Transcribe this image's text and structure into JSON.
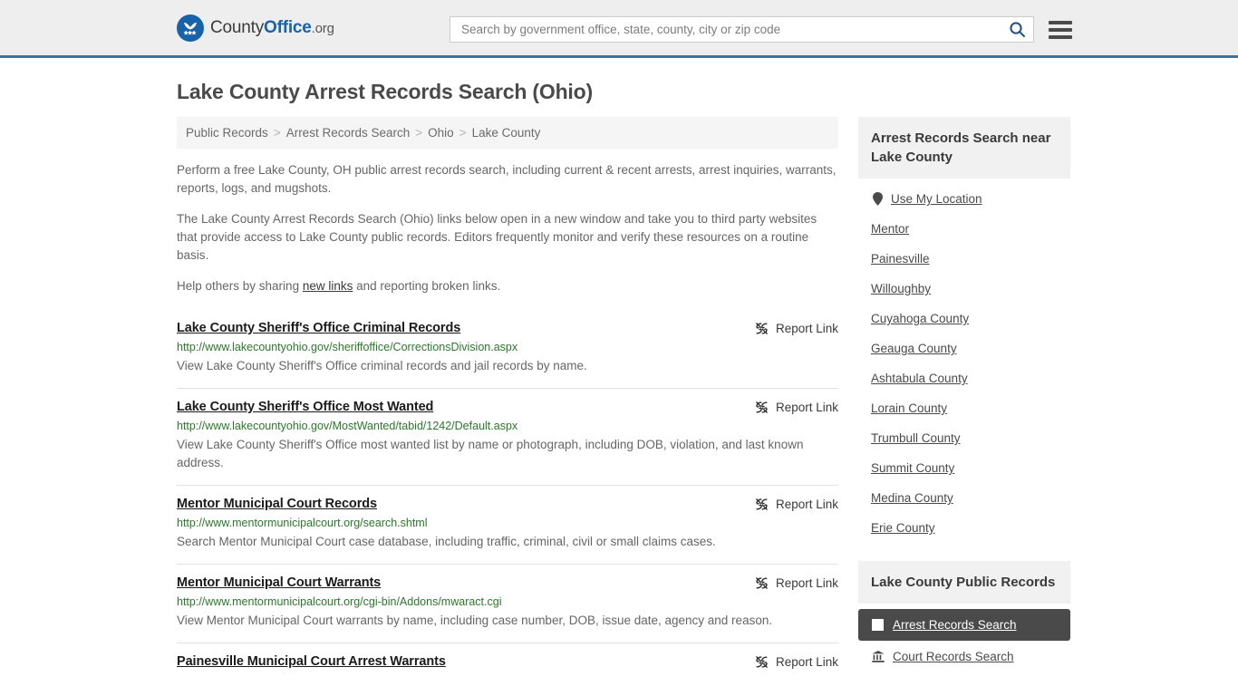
{
  "header": {
    "logo_name_part1": "County",
    "logo_name_part2": "Office",
    "logo_name_part3": ".org",
    "search_placeholder": "Search by government office, state, county, city or zip code",
    "search_value": "",
    "search_icon": "search-icon",
    "menu_icon": "hamburger-menu-icon",
    "accent_color": "#1763ab",
    "border_color": "#3a72a8"
  },
  "page_title": "Lake County Arrest Records Search (Ohio)",
  "breadcrumb": [
    "Public Records",
    "Arrest Records Search",
    "Ohio",
    "Lake County"
  ],
  "breadcrumb_separator": ">",
  "intro": {
    "p1": "Perform a free Lake County, OH public arrest records search, including current & recent arrests, arrest inquiries, warrants, reports, logs, and mugshots.",
    "p2": "The Lake County Arrest Records Search (Ohio) links below open in a new window and take you to third party websites that provide access to Lake County public records. Editors frequently monitor and verify these resources on a routine basis.",
    "p3_before": "Help others by sharing ",
    "p3_link": "new links",
    "p3_after": " and reporting broken links."
  },
  "report_link_label": "Report Link",
  "report_link_icon": "broken-chain-icon",
  "results": [
    {
      "title": "Lake County Sheriff's Office Criminal Records",
      "url": "http://www.lakecountyohio.gov/sheriffoffice/CorrectionsDivision.aspx",
      "description": "View Lake County Sheriff's Office criminal records and jail records by name."
    },
    {
      "title": "Lake County Sheriff's Office Most Wanted",
      "url": "http://www.lakecountyohio.gov/MostWanted/tabid/1242/Default.aspx",
      "description": "View Lake County Sheriff's Office most wanted list by name or photograph, including DOB, violation, and last known address."
    },
    {
      "title": "Mentor Municipal Court Records",
      "url": "http://www.mentormunicipalcourt.org/search.shtml",
      "description": "Search Mentor Municipal Court case database, including traffic, criminal, civil or small claims cases."
    },
    {
      "title": "Mentor Municipal Court Warrants",
      "url": "http://www.mentormunicipalcourt.org/cgi-bin/Addons/mwaract.cgi",
      "description": "View Mentor Municipal Court warrants by name, including case number, DOB, issue date, agency and reason."
    },
    {
      "title": "Painesville Municipal Court Arrest Warrants",
      "url": "",
      "description": ""
    }
  ],
  "sidebar": {
    "near_heading": "Arrest Records Search near Lake County",
    "use_my_location": {
      "label": "Use My Location",
      "icon": "map-pin-icon"
    },
    "near_links": [
      "Mentor",
      "Painesville",
      "Willoughby",
      "Cuyahoga County",
      "Geauga County",
      "Ashtabula County",
      "Lorain County",
      "Trumbull County",
      "Summit County",
      "Medina County",
      "Erie County"
    ],
    "public_records_heading": "Lake County Public Records",
    "public_records_items": [
      {
        "label": "Arrest Records Search",
        "icon": "square-icon",
        "active": true
      },
      {
        "label": "Court Records Search",
        "icon": "courthouse-icon",
        "active": false
      }
    ]
  }
}
